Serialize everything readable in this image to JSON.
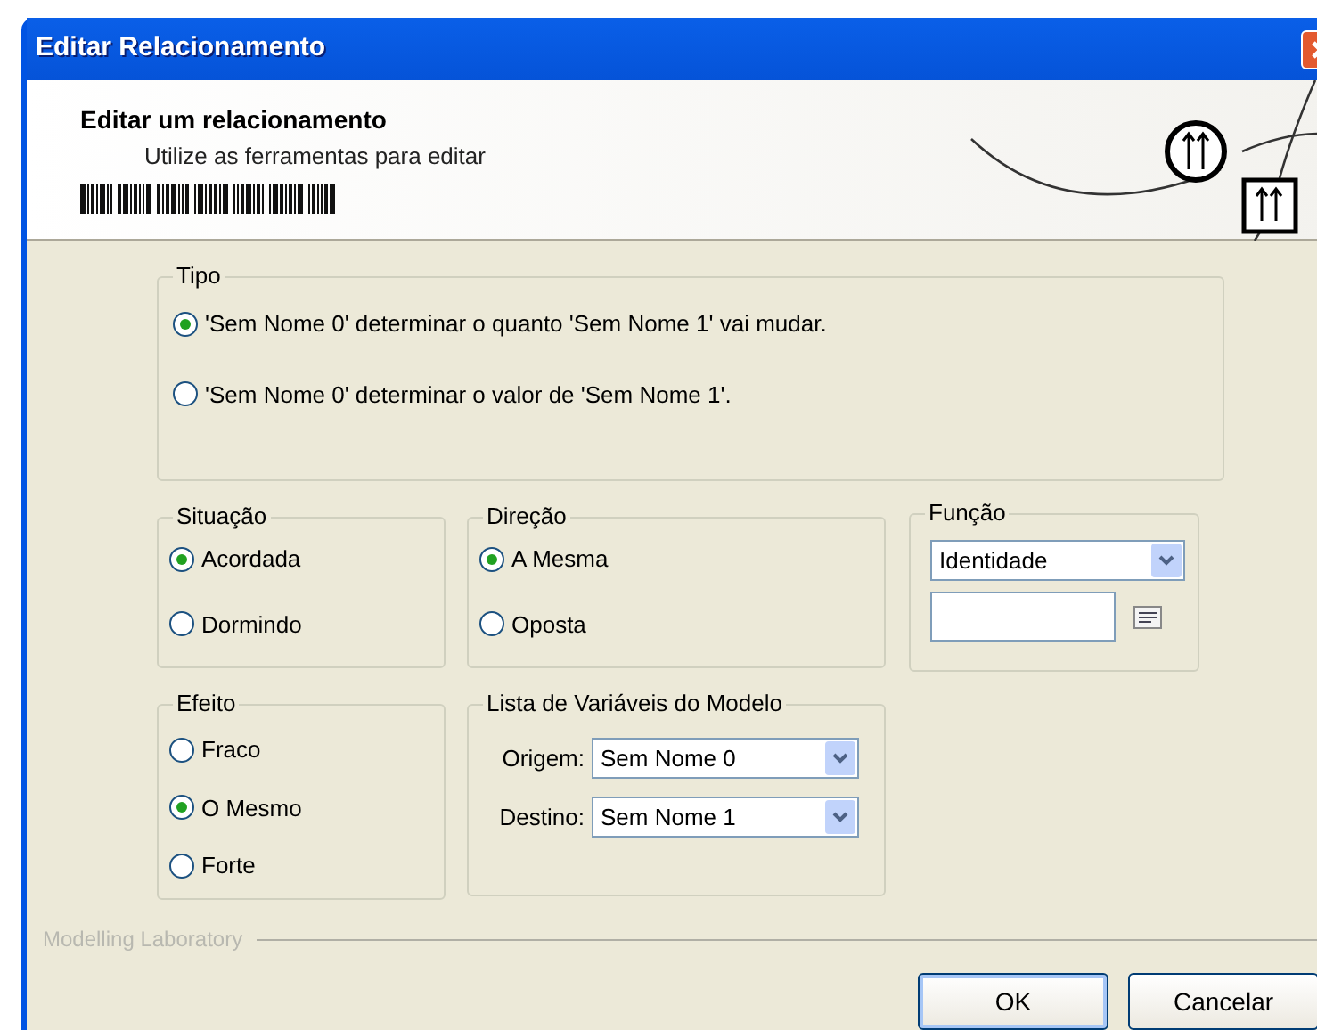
{
  "window": {
    "title": "Editar Relacionamento"
  },
  "header": {
    "title": "Editar um relacionamento",
    "subtitle": "Utilize as ferramentas para editar"
  },
  "tipo": {
    "legend": "Tipo",
    "options": [
      {
        "label": "'Sem Nome 0' determinar o quanto 'Sem Nome 1' vai mudar.",
        "selected": true
      },
      {
        "label": "'Sem Nome 0' determinar o valor de 'Sem Nome 1'.",
        "selected": false
      }
    ]
  },
  "situacao": {
    "legend": "Situação",
    "options": [
      {
        "label": "Acordada",
        "selected": true
      },
      {
        "label": "Dormindo",
        "selected": false
      }
    ]
  },
  "direcao": {
    "legend": "Direção",
    "options": [
      {
        "label": "A Mesma",
        "selected": true
      },
      {
        "label": "Oposta",
        "selected": false
      }
    ]
  },
  "funcao": {
    "legend": "Função",
    "select": {
      "value": "Identidade"
    }
  },
  "efeito": {
    "legend": "Efeito",
    "options": [
      {
        "label": "Fraco",
        "selected": false
      },
      {
        "label": "O Mesmo",
        "selected": true
      },
      {
        "label": "Forte",
        "selected": false
      }
    ]
  },
  "lista": {
    "legend": "Lista de Variáveis do Modelo",
    "fields": [
      {
        "label": "Origem:",
        "value": "Sem Nome 0"
      },
      {
        "label": "Destino:",
        "value": "Sem Nome 1"
      }
    ]
  },
  "footer": {
    "brand": "Modelling Laboratory"
  },
  "buttons": [
    {
      "label": "OK",
      "kind": "default"
    },
    {
      "label": "Cancelar",
      "kind": "normal"
    }
  ]
}
